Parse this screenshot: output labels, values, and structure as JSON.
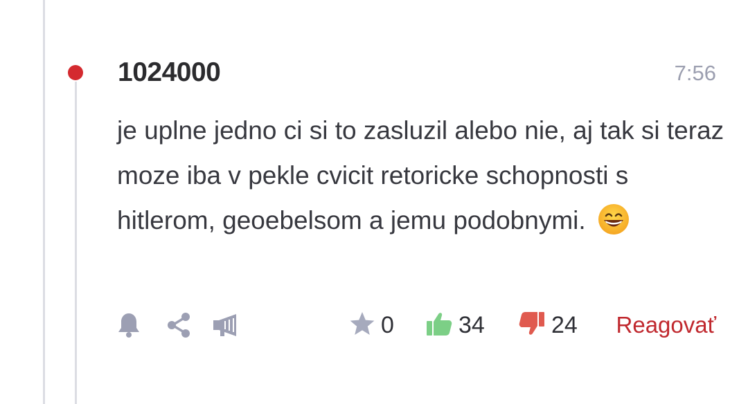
{
  "comment": {
    "author": "1024000",
    "time": "7:56",
    "text": "je uplne jedno ci si to zasluzil alebo nie, aj tak si teraz moze iba v pekle cvicit retoricke schopnosti s hitlerom, geoebelsom a jemu podobnymi."
  },
  "actions": {
    "icons": [
      "bell-icon",
      "share-icon",
      "megaphone-icon"
    ],
    "stars": "0",
    "likes": "34",
    "dislikes": "24",
    "reply_label": "Reagovať"
  },
  "colors": {
    "accent": "#c0282e",
    "unread_dot": "#d42a2f",
    "icon_gray": "#9c9fb3",
    "like_green": "#7ccf86",
    "dislike_red": "#e05a4f"
  }
}
